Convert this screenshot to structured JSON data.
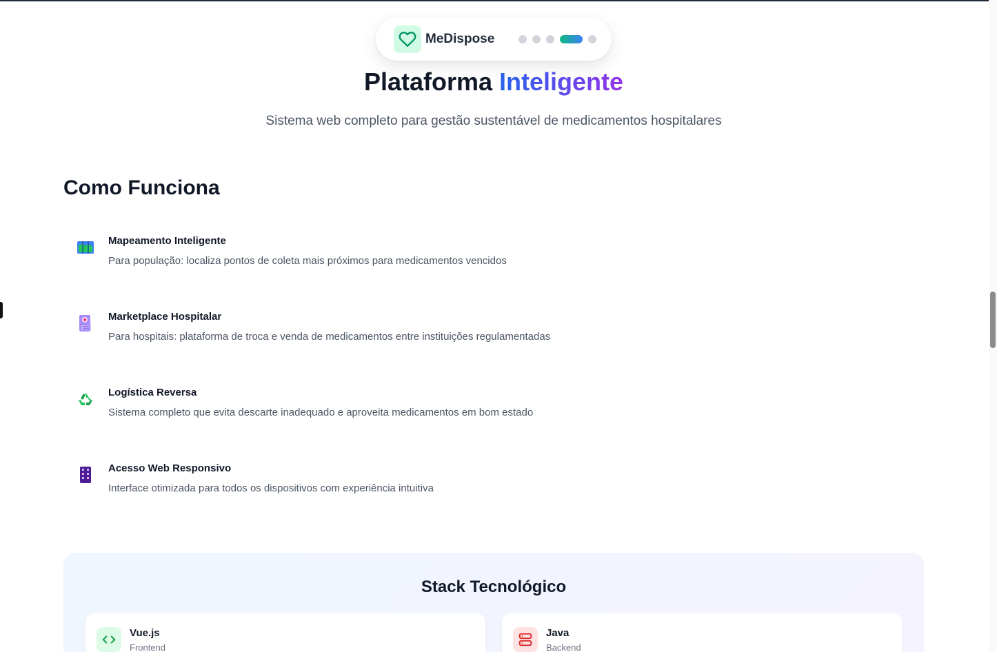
{
  "nav": {
    "brand": "MeDispose",
    "logo_icon": "heart-icon",
    "carousel_dots": 5,
    "active_dot_index": 3
  },
  "hero": {
    "title_main": "Plataforma",
    "title_accent": "Inteligente",
    "subtitle": "Sistema web completo para gestão sustentável de medicamentos hospitalares"
  },
  "how_it_works": {
    "title": "Como Funciona",
    "features": [
      {
        "icon": "map-icon",
        "title": "Mapeamento Inteligente",
        "description": "Para população: localiza pontos de coleta mais próximos para medicamentos vencidos"
      },
      {
        "icon": "hospital-icon",
        "title": "Marketplace Hospitalar",
        "description": "Para hospitais: plataforma de troca e venda de medicamentos entre instituições regulamentadas"
      },
      {
        "icon": "recycle-icon",
        "title": "Logística Reversa",
        "description": "Sistema completo que evita descarte inadequado e aproveita medicamentos em bom estado"
      },
      {
        "icon": "building-icon",
        "title": "Acesso Web Responsivo",
        "description": "Interface otimizada para todos os dispositivos com experiência intuitiva"
      }
    ]
  },
  "stack": {
    "title": "Stack Tecnológico",
    "items": [
      {
        "icon": "code-icon",
        "name": "Vue.js",
        "role": "Frontend",
        "color": "#16a34a",
        "bg": "#dcfce7"
      },
      {
        "icon": "server-icon",
        "name": "Java",
        "role": "Backend",
        "color": "#dc2626",
        "bg": "#fee2e2"
      }
    ]
  },
  "colors": {
    "accent_gradient_start": "#2563eb",
    "accent_gradient_end": "#9333ea",
    "brand_green": "#10b981"
  }
}
